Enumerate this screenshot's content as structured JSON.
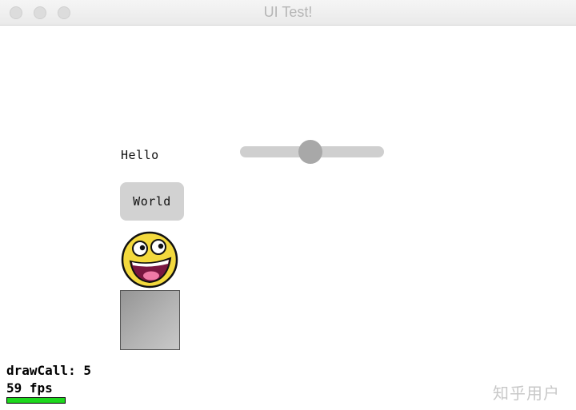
{
  "window": {
    "title": "UI Test!"
  },
  "widgets": {
    "label_text": "Hello",
    "button_label": "World",
    "slider_value_fraction": 0.49,
    "image_icon": "awesome-face-icon"
  },
  "stats": {
    "draw_call_text": "drawCall: 5",
    "fps_text": "59 fps",
    "fps_bar_fraction": 1.0,
    "fps_bar_color": "#1ed81e"
  },
  "watermark": {
    "text": "知乎用户"
  }
}
